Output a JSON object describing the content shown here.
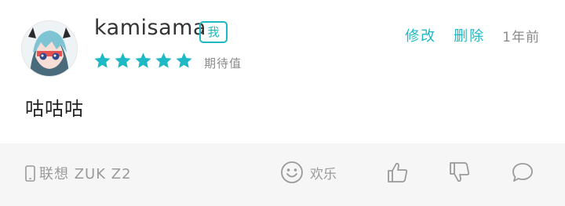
{
  "comment": {
    "username": "kamisama",
    "self_badge": "我",
    "rating": {
      "stars": 5,
      "max": 5,
      "label": "期待值",
      "color": "#1eb9c4"
    },
    "actions": {
      "edit": "修改",
      "delete": "删除"
    },
    "timestamp": "1年前",
    "content": "咕咕咕"
  },
  "footer": {
    "device_icon": "phone-icon",
    "device": "联想 ZUK Z2",
    "reaction_icon": "smiley-icon",
    "reaction_label": "欢乐",
    "like_icon": "thumbs-up-icon",
    "dislike_icon": "thumbs-down-icon",
    "reply_icon": "comment-bubble-icon"
  }
}
